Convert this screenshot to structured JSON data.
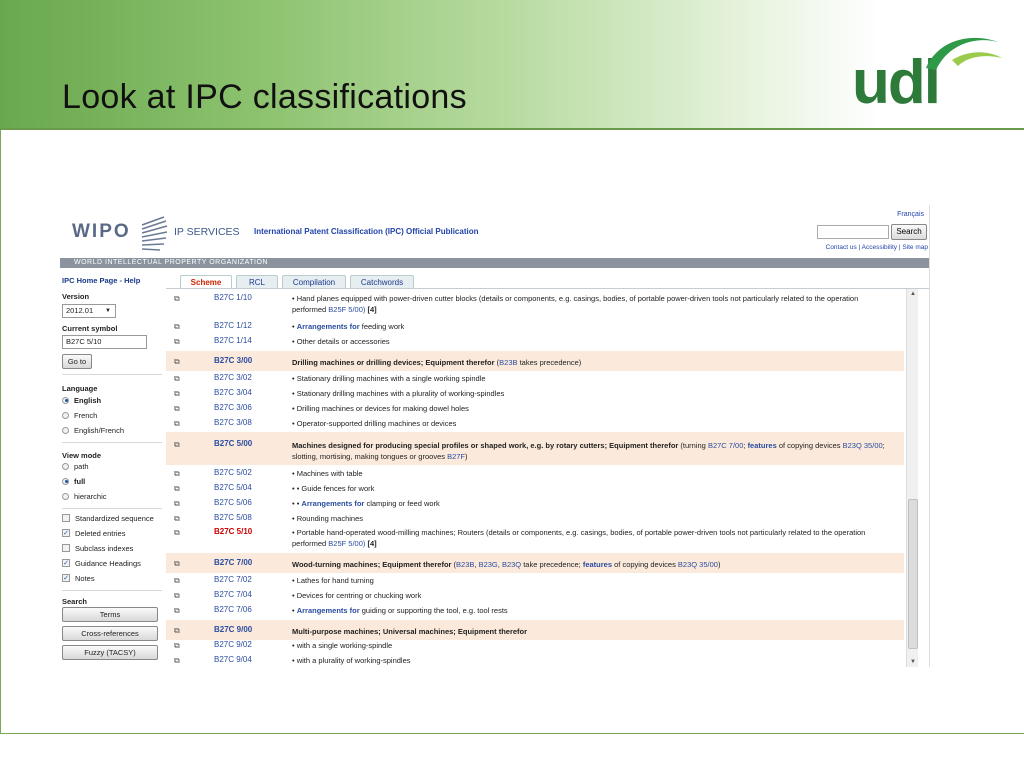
{
  "slide": {
    "title": "Look at IPC classifications",
    "logo_text": "udl"
  },
  "wipo": {
    "logo": "WIPO",
    "ip_services": "IP SERVICES",
    "publication": "International Patent Classification (IPC) Official Publication",
    "lang_link": "Français",
    "search_button": "Search",
    "top_links": "Contact us | Accessibility | Site map",
    "org_bar": "WORLD INTELLECTUAL PROPERTY ORGANIZATION"
  },
  "sidebar": {
    "home_links": "IPC Home Page  -  Help",
    "version_label": "Version",
    "version_value": "2012.01",
    "current_symbol_label": "Current symbol",
    "current_symbol_value": "B27C 5/10",
    "goto_button": "Go to",
    "language_label": "Language",
    "languages": [
      "English",
      "French",
      "English/French"
    ],
    "view_mode_label": "View mode",
    "view_modes": [
      "path",
      "full",
      "hierarchic"
    ],
    "options": [
      "Standardized sequence",
      "Deleted entries",
      "Subclass indexes",
      "Guidance Headings",
      "Notes"
    ],
    "search_label": "Search",
    "search_buttons": [
      "Terms",
      "Cross-references",
      "Fuzzy (TACSY)"
    ]
  },
  "tabs": [
    "Scheme",
    "RCL",
    "Compilation",
    "Catchwords"
  ],
  "rows": [
    {
      "sym": "B27C 1/10",
      "desc": "• Hand planes equipped with power-driven cutter blocks (details or components, e.g. casings, bodies, of portable power-driven tools not particularly related to the operation",
      "desc2": "performed ",
      "link2": "B25F 5/00)",
      "tag2": " [4]"
    },
    {
      "sym": "B27C 1/12",
      "prefix": "• ",
      "linkb": "Arrangements for",
      "rest": " feeding work"
    },
    {
      "sym": "B27C 1/14",
      "desc": "• Other details or accessories"
    },
    {
      "sym": "B27C 3/00",
      "main": "Drilling machines or drilling devices; Equipment therefor",
      "after1": " (",
      "link1": "B23B",
      "after2": " takes precedence)"
    },
    {
      "sym": "B27C 3/02",
      "desc": "• Stationary drilling machines with a single working spindle"
    },
    {
      "sym": "B27C 3/04",
      "desc": "• Stationary drilling machines with a plurality of working-spindles"
    },
    {
      "sym": "B27C 3/06",
      "desc": "• Drilling machines or devices for making dowel holes"
    },
    {
      "sym": "B27C 3/08",
      "desc": "• Operator-supported drilling machines or devices"
    },
    {
      "sym": "B27C 5/00",
      "main": "Machines designed for producing special profiles or shaped work, e.g. by rotary cutters; Equipment therefor",
      "t1": " (turning ",
      "l1": "B27C 7/00",
      "t2": "; ",
      "l2": "features",
      "t3": " of copying devices ",
      "l3": "B23Q 35/00",
      "t4": ";",
      "line2": "slotting, mortising, making tongues or grooves ",
      "l4": "B27F",
      "t5": ")"
    },
    {
      "sym": "B27C 5/02",
      "desc": "• Machines with table"
    },
    {
      "sym": "B27C 5/04",
      "desc": "• • Guide fences for work"
    },
    {
      "sym": "B27C 5/06",
      "prefix": "• • ",
      "linkb": "Arrangements for",
      "rest": " clamping or feed work"
    },
    {
      "sym": "B27C 5/08",
      "desc": "• Rounding machines"
    },
    {
      "sym": "B27C 5/10",
      "desc": "• Portable hand-operated wood-milling machines; Routers (details or components, e.g. casings, bodies, of portable power-driven tools not particularly related to the operation",
      "desc2": "performed ",
      "link2": "B25F 5/00)",
      "tag2": " [4]"
    },
    {
      "sym": "B27C 7/00",
      "main": "Wood-turning machines; Equipment therefor",
      "t1": " (",
      "l1": "B23B",
      "t2": ", ",
      "l2": "B23G",
      "t3": ", ",
      "l3": "B23Q",
      "t4": " take precedence; ",
      "l4": "features",
      "t5": " of copying devices ",
      "l5": "B23Q 35/00",
      "t6": ")"
    },
    {
      "sym": "B27C 7/02",
      "desc": "• Lathes for hand turning"
    },
    {
      "sym": "B27C 7/04",
      "desc": "• Devices for centring or chucking work"
    },
    {
      "sym": "B27C 7/06",
      "prefix": "• ",
      "linkb": "Arrangements for",
      "rest": " guiding or supporting the tool, e.g. tool rests"
    },
    {
      "sym": "B27C 9/00",
      "main": "Multi-purpose machines; Universal machines; Equipment therefor"
    },
    {
      "sym": "B27C 9/02",
      "desc": "• with a single working-spindle"
    },
    {
      "sym": "B27C 9/04",
      "desc": "• with a plurality of working-spindles"
    }
  ],
  "colors": {
    "accent_green": "#6aa84f",
    "logo_green": "#2e7a3a",
    "highlight_row": "#fbeadb",
    "link_blue": "#2a4ca0",
    "current_red": "#cc0000"
  }
}
